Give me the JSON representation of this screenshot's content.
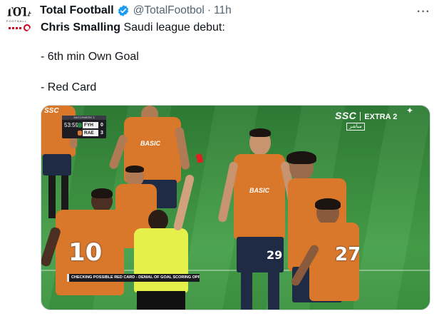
{
  "tweet": {
    "avatar": {
      "logo_top": "TOTAL",
      "logo_mid": "FOOTBALL"
    },
    "author_name": "Total Football",
    "handle": "@TotalFootbol",
    "separator": "·",
    "time": "11h",
    "more": "···",
    "text": {
      "line1_bold": "Chris Smalling",
      "line1_rest": " Saudi league debut:",
      "line2": "- 6th min Own Goal",
      "line3": "- Red Card"
    },
    "verified_color": "#1d9bf0"
  },
  "media": {
    "broadcast": {
      "channel": "SSC",
      "channel_sub": "EXTRA 2",
      "live_badge": "مباشر",
      "corner_logo": "SSC"
    },
    "scoreboard": {
      "header": "MATCHWEEK 3",
      "clock": "53:59",
      "team1": "FYH",
      "score1": "0",
      "team2": "RAE",
      "score2": "3"
    },
    "var_caption": "CHECKING POSSIBLE RED CARD - DENIAL OF GOAL SCORING OPPORTUNITY",
    "jersey_sponsor": "BASIC",
    "jersey_numbers": [
      "10",
      "29",
      "27"
    ],
    "colors": {
      "jersey": "#d9772a",
      "shorts": "#1f2a44",
      "referee": "#e6f04a",
      "card": "#e02020",
      "pitch": "#3b8f3f"
    }
  }
}
